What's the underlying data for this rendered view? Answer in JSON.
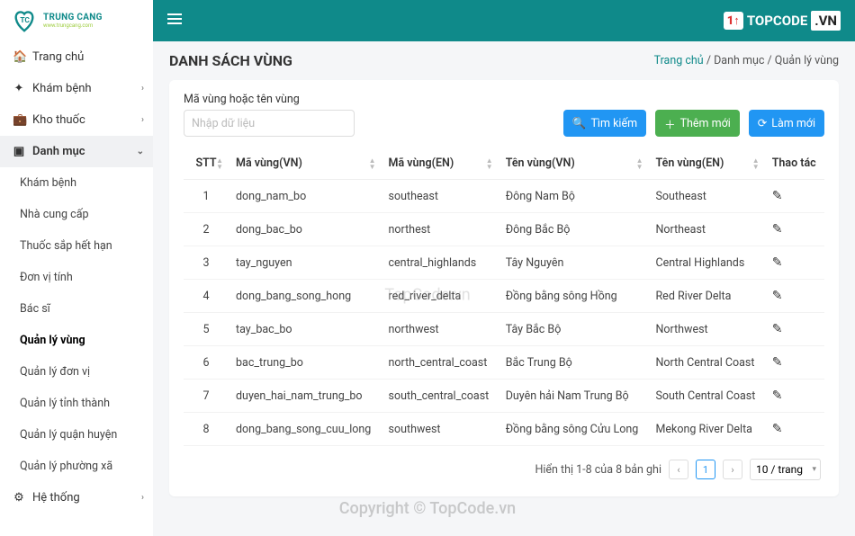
{
  "brand": {
    "name": "TRUNG CANG",
    "sub": "www.trungcang.com"
  },
  "topcode": {
    "label": "TOPCODE",
    "suffix": ".VN",
    "icon": "1↑"
  },
  "sidebar": {
    "home": "Trang chủ",
    "kham_benh": "Khám bệnh",
    "kho_thuoc": "Kho thuốc",
    "danh_muc": "Danh mục",
    "he_thong": "Hệ thống",
    "sub": [
      "Khám bệnh",
      "Nhà cung cấp",
      "Thuốc sắp hết hạn",
      "Đơn vị tính",
      "Bác sĩ",
      "Quản lý vùng",
      "Quản lý đơn vị",
      "Quản lý tỉnh thành",
      "Quản lý quận huyện",
      "Quản lý phường xã"
    ]
  },
  "page": {
    "title": "DANH SÁCH VÙNG",
    "breadcrumb": {
      "home": "Trang chủ",
      "cat": "Danh mục",
      "cur": "Quản lý vùng",
      "sep": "/"
    }
  },
  "filter": {
    "label": "Mã vùng hoặc tên vùng",
    "placeholder": "Nhập dữ liệu",
    "search": "Tìm kiếm",
    "add": "Thêm mới",
    "reload": "Làm mới"
  },
  "table": {
    "headers": {
      "stt": "STT",
      "code_vn": "Mã vùng(VN)",
      "code_en": "Mã vùng(EN)",
      "name_vn": "Tên vùng(VN)",
      "name_en": "Tên vùng(EN)",
      "action": "Thao tác"
    },
    "rows": [
      {
        "stt": 1,
        "code_vn": "dong_nam_bo",
        "code_en": "southeast",
        "name_vn": "Đông Nam Bộ",
        "name_en": "Southeast"
      },
      {
        "stt": 2,
        "code_vn": "dong_bac_bo",
        "code_en": "northest",
        "name_vn": "Đông Bắc Bộ",
        "name_en": "Northeast"
      },
      {
        "stt": 3,
        "code_vn": "tay_nguyen",
        "code_en": "central_highlands",
        "name_vn": "Tây Nguyên",
        "name_en": "Central Highlands"
      },
      {
        "stt": 4,
        "code_vn": "dong_bang_song_hong",
        "code_en": "red_river_delta",
        "name_vn": "Đồng bằng sông Hồng",
        "name_en": "Red River Delta"
      },
      {
        "stt": 5,
        "code_vn": "tay_bac_bo",
        "code_en": "northwest",
        "name_vn": "Tây Bắc Bộ",
        "name_en": "Northwest"
      },
      {
        "stt": 6,
        "code_vn": "bac_trung_bo",
        "code_en": "north_central_coast",
        "name_vn": "Bắc Trung Bộ",
        "name_en": "North Central Coast"
      },
      {
        "stt": 7,
        "code_vn": "duyen_hai_nam_trung_bo",
        "code_en": "south_central_coast",
        "name_vn": "Duyên hải Nam Trung Bộ",
        "name_en": "South Central Coast"
      },
      {
        "stt": 8,
        "code_vn": "dong_bang_song_cuu_long",
        "code_en": "southwest",
        "name_vn": "Đồng bằng sông Cửu Long",
        "name_en": "Mekong River Delta"
      }
    ]
  },
  "paging": {
    "info": "Hiển thị 1-8 của 8 bản ghi",
    "page": "1",
    "size": "10 / trang"
  },
  "watermark": "TopCode.vn",
  "copyright": "Copyright © TopCode.vn"
}
